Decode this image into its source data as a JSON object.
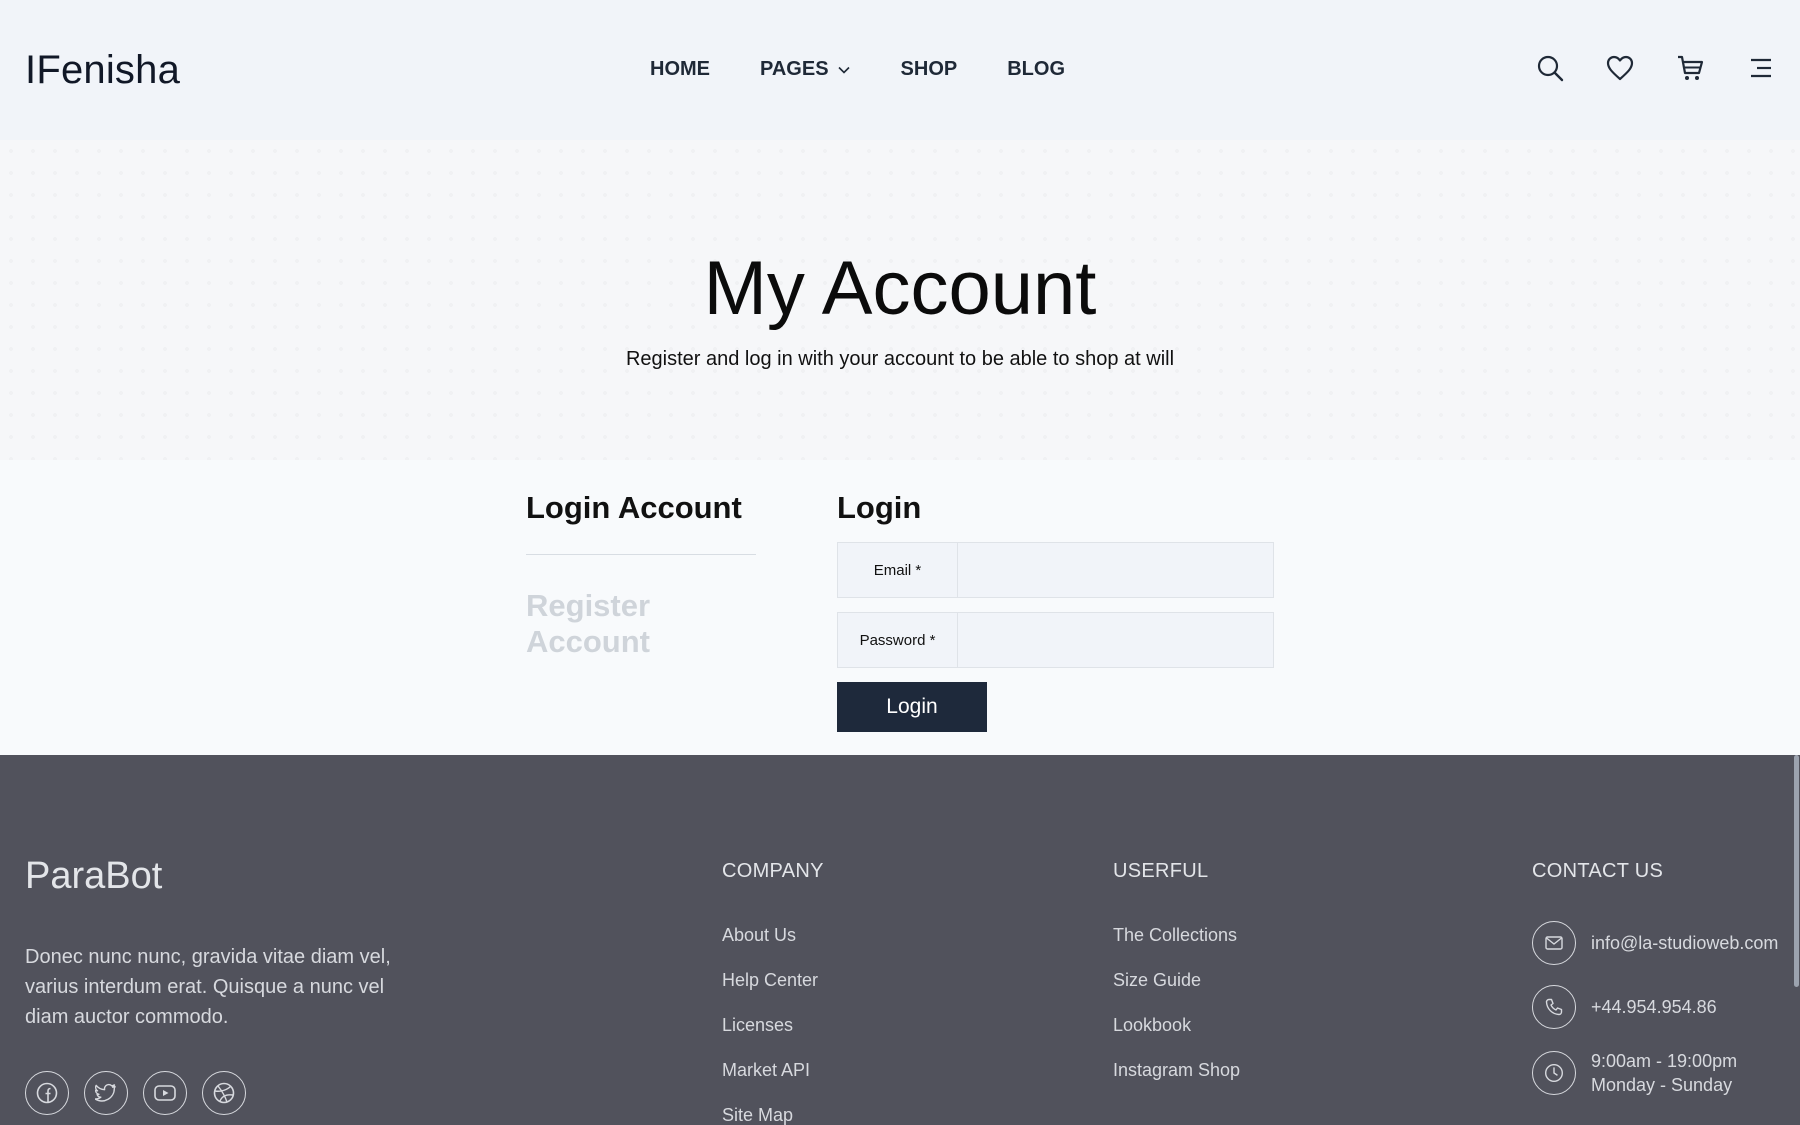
{
  "header": {
    "logo": "IFenisha",
    "nav": [
      {
        "label": "HOME"
      },
      {
        "label": "PAGES"
      },
      {
        "label": "SHOP"
      },
      {
        "label": "BLOG"
      }
    ],
    "icons": [
      "search-icon",
      "heart-icon",
      "cart-icon",
      "menu-icon"
    ]
  },
  "hero": {
    "title": "My Account",
    "subtitle": "Register and log in with your account to be able to shop at will"
  },
  "account": {
    "tabs": {
      "login": "Login Account",
      "register": "Register Account"
    },
    "form": {
      "title": "Login",
      "email_label": "Email *",
      "email_value": "",
      "password_label": "Password *",
      "password_value": "",
      "submit_label": "Login"
    }
  },
  "footer": {
    "brand": "ParaBot",
    "description": "Donec nunc nunc, gravida vitae diam vel, varius interdum erat. Quisque a nunc vel diam auctor commodo.",
    "socials": [
      "facebook-icon",
      "twitter-icon",
      "youtube-icon",
      "dribbble-icon"
    ],
    "company": {
      "heading": "COMPANY",
      "links": [
        "About Us",
        "Help Center",
        "Licenses",
        "Market API",
        "Site Map"
      ]
    },
    "useful": {
      "heading": "USERFUL",
      "links": [
        "The Collections",
        "Size Guide",
        "Lookbook",
        "Instagram Shop"
      ]
    },
    "contact": {
      "heading": "CONTACT US",
      "email": "info@la-studioweb.com",
      "phone": "+44.954.954.86",
      "hours_line1": "9:00am - 19:00pm",
      "hours_line2": "Monday - Sunday"
    }
  },
  "colors": {
    "header_bg": "#f1f4f9",
    "footer_bg": "#51525c",
    "button_bg": "#1e293b",
    "inactive_tab": "#cfd4da"
  }
}
